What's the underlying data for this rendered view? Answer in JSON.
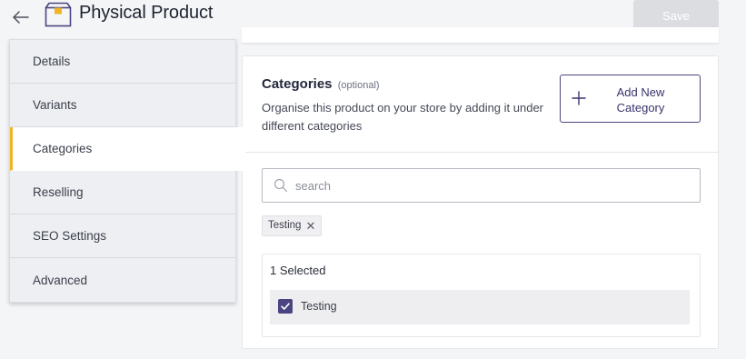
{
  "header": {
    "title": "Physical Product",
    "save_label": "Save"
  },
  "sidebar": {
    "items": [
      {
        "label": "Details"
      },
      {
        "label": "Variants"
      },
      {
        "label": "Categories",
        "active": true
      },
      {
        "label": "Reselling"
      },
      {
        "label": "SEO Settings"
      },
      {
        "label": "Advanced"
      }
    ]
  },
  "categories": {
    "title": "Categories",
    "optional": "(optional)",
    "description": "Organise this product on your store by adding it under different categories",
    "add_button_label": "Add New Category",
    "search": {
      "placeholder": "search",
      "value": ""
    },
    "chips": [
      {
        "label": "Testing"
      }
    ],
    "selected_count_label": "1 Selected",
    "selected_items": [
      {
        "label": "Testing",
        "checked": true
      }
    ]
  },
  "colors": {
    "accent": "#4a4580",
    "active_indicator": "#f0b429",
    "save_disabled": "#dcdde0"
  },
  "icons": {
    "back": "arrow-left-icon",
    "product": "box-icon",
    "add": "plus-icon",
    "search": "search-icon",
    "remove": "close-icon",
    "check": "check-icon"
  }
}
